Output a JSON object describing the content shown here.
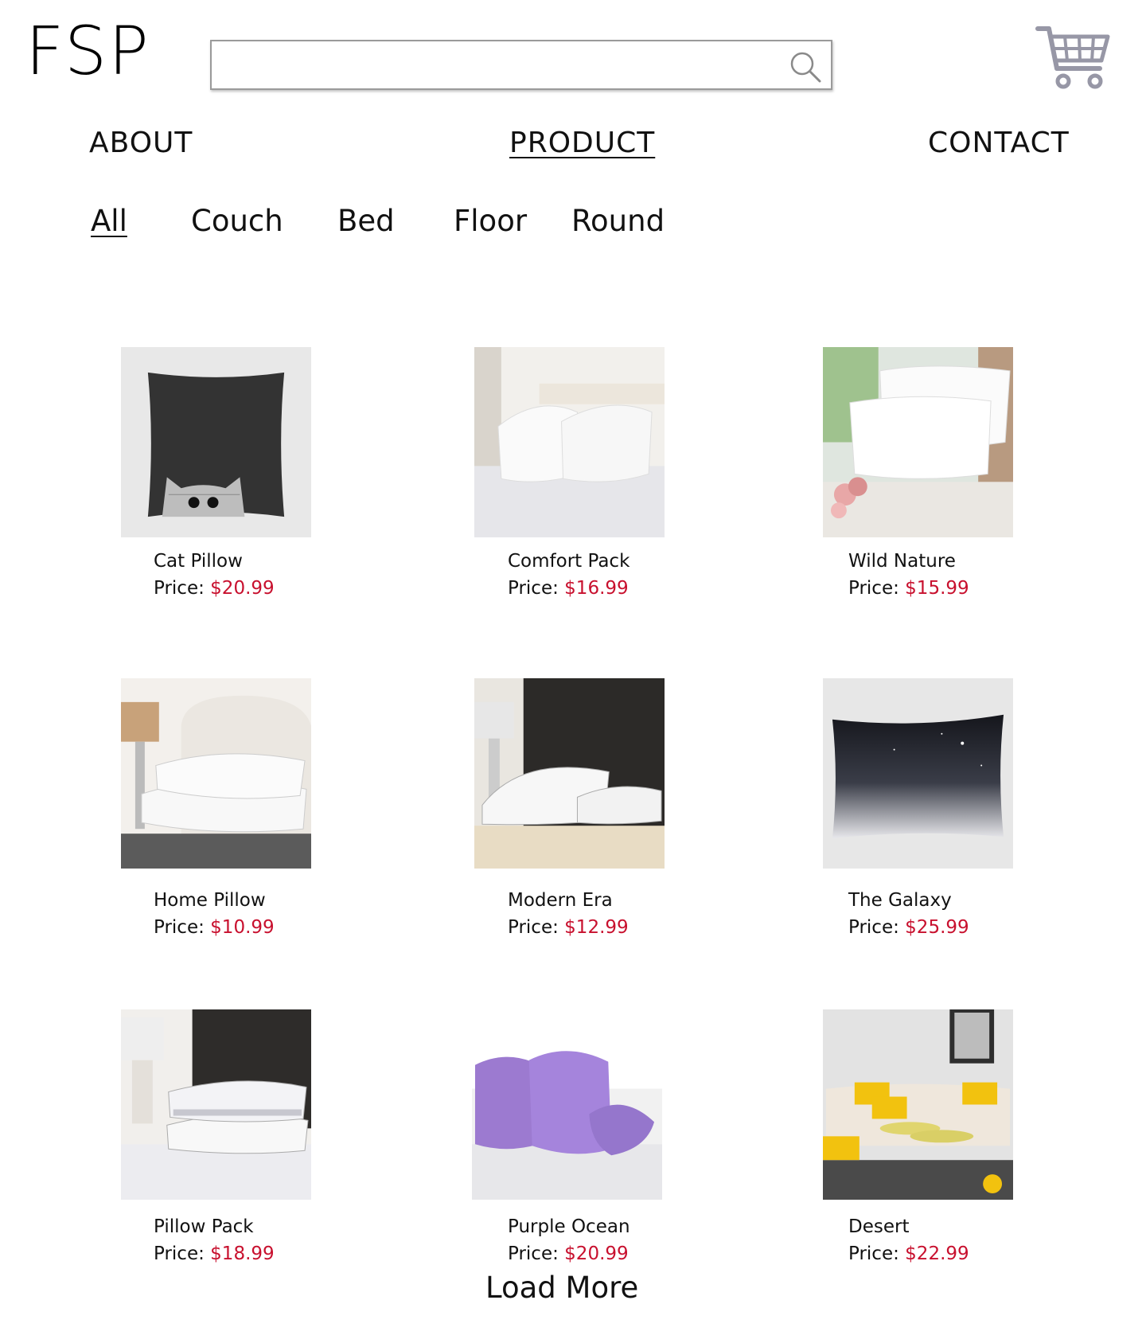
{
  "header": {
    "logo": "FSP",
    "search": {
      "value": "",
      "placeholder": ""
    },
    "icons": {
      "search": "search-icon",
      "cart": "shopping-cart-icon"
    }
  },
  "nav": {
    "items": [
      {
        "label": "ABOUT",
        "active": false
      },
      {
        "label": "PRODUCT",
        "active": true
      },
      {
        "label": "CONTACT",
        "active": false
      }
    ]
  },
  "filters": {
    "items": [
      {
        "label": "All",
        "active": true
      },
      {
        "label": "Couch",
        "active": false
      },
      {
        "label": "Bed",
        "active": false
      },
      {
        "label": "Floor",
        "active": false
      },
      {
        "label": "Round",
        "active": false
      }
    ]
  },
  "products": {
    "price_label": "Price:",
    "items": [
      {
        "name": "Cat Pillow",
        "price": "$20.99",
        "image": "black-cat-pillow"
      },
      {
        "name": "Comfort Pack",
        "price": "$16.99",
        "image": "white-bed-pillows"
      },
      {
        "name": "Wild Nature",
        "price": "$15.99",
        "image": "pillows-by-window"
      },
      {
        "name": "Home Pillow",
        "price": "$10.99",
        "image": "stacked-white-pillows"
      },
      {
        "name": "Modern Era",
        "price": "$12.99",
        "image": "pillows-dark-headboard"
      },
      {
        "name": "The Galaxy",
        "price": "$25.99",
        "image": "night-sky-pillow"
      },
      {
        "name": "Pillow Pack",
        "price": "$18.99",
        "image": "striped-pillow-stack"
      },
      {
        "name": "Purple Ocean",
        "price": "$20.99",
        "image": "purple-pillows"
      },
      {
        "name": "Desert",
        "price": "$22.99",
        "image": "yellow-striped-sofa"
      }
    ]
  },
  "load_more": "Load More",
  "colors": {
    "price": "#c8102e",
    "text": "#111111",
    "border": "#9a9a9a"
  }
}
